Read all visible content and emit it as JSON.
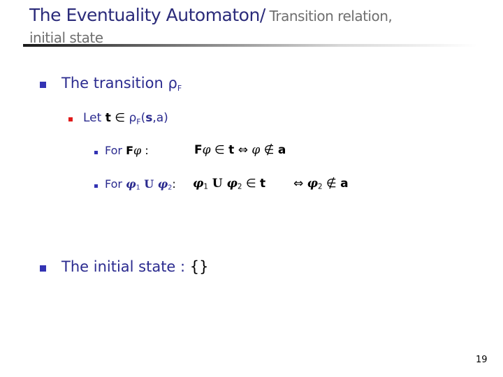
{
  "title": {
    "main": "The Eventuality Automaton/",
    "sub_part1": " Transition relation,",
    "sub_part2": "initial state"
  },
  "bullets": [
    {
      "level": 1,
      "text": "The transition ",
      "symbol": "ρ",
      "subscript": "F",
      "children": [
        {
          "level": 2,
          "text_let": "Let ",
          "t": "t",
          "in": " ∈ ",
          "rho": "ρ",
          "subscript": "F",
          "open": "(",
          "s": "s",
          "rest": ",a)",
          "children": [
            {
              "level": 3,
              "label_for": "For ",
              "label_F": "F",
              "label_phi": "φ",
              "label_colon": " :",
              "rhs_F": "F",
              "rhs_phi": "φ",
              "rhs_in": " ∈ ",
              "rhs_t": "t",
              "rhs_iff": " ⇔ ",
              "rhs_phi2": "φ",
              "rhs_notin": " ∉ ",
              "rhs_a": "a"
            },
            {
              "level": 3,
              "label_for": "For ",
              "label_phi1": "φ",
              "label_sub1": "1",
              "label_U": " U ",
              "label_phi2": "φ",
              "label_sub2": "2",
              "label_colon": ":",
              "rhs_phi1": "φ",
              "rhs_sub1": "1",
              "rhs_U": " U ",
              "rhs_phi2": "φ",
              "rhs_sub2": "2",
              "rhs_in": " ∈ ",
              "rhs_t": "t",
              "rhs_iff": "⇔ ",
              "rhs_phi3": "φ",
              "rhs_sub3": "2",
              "rhs_notin": " ∉ ",
              "rhs_a": "a"
            }
          ]
        }
      ]
    },
    {
      "level": 1,
      "text": "The initial state : ",
      "value": "{}"
    }
  ],
  "page_number": "19"
}
